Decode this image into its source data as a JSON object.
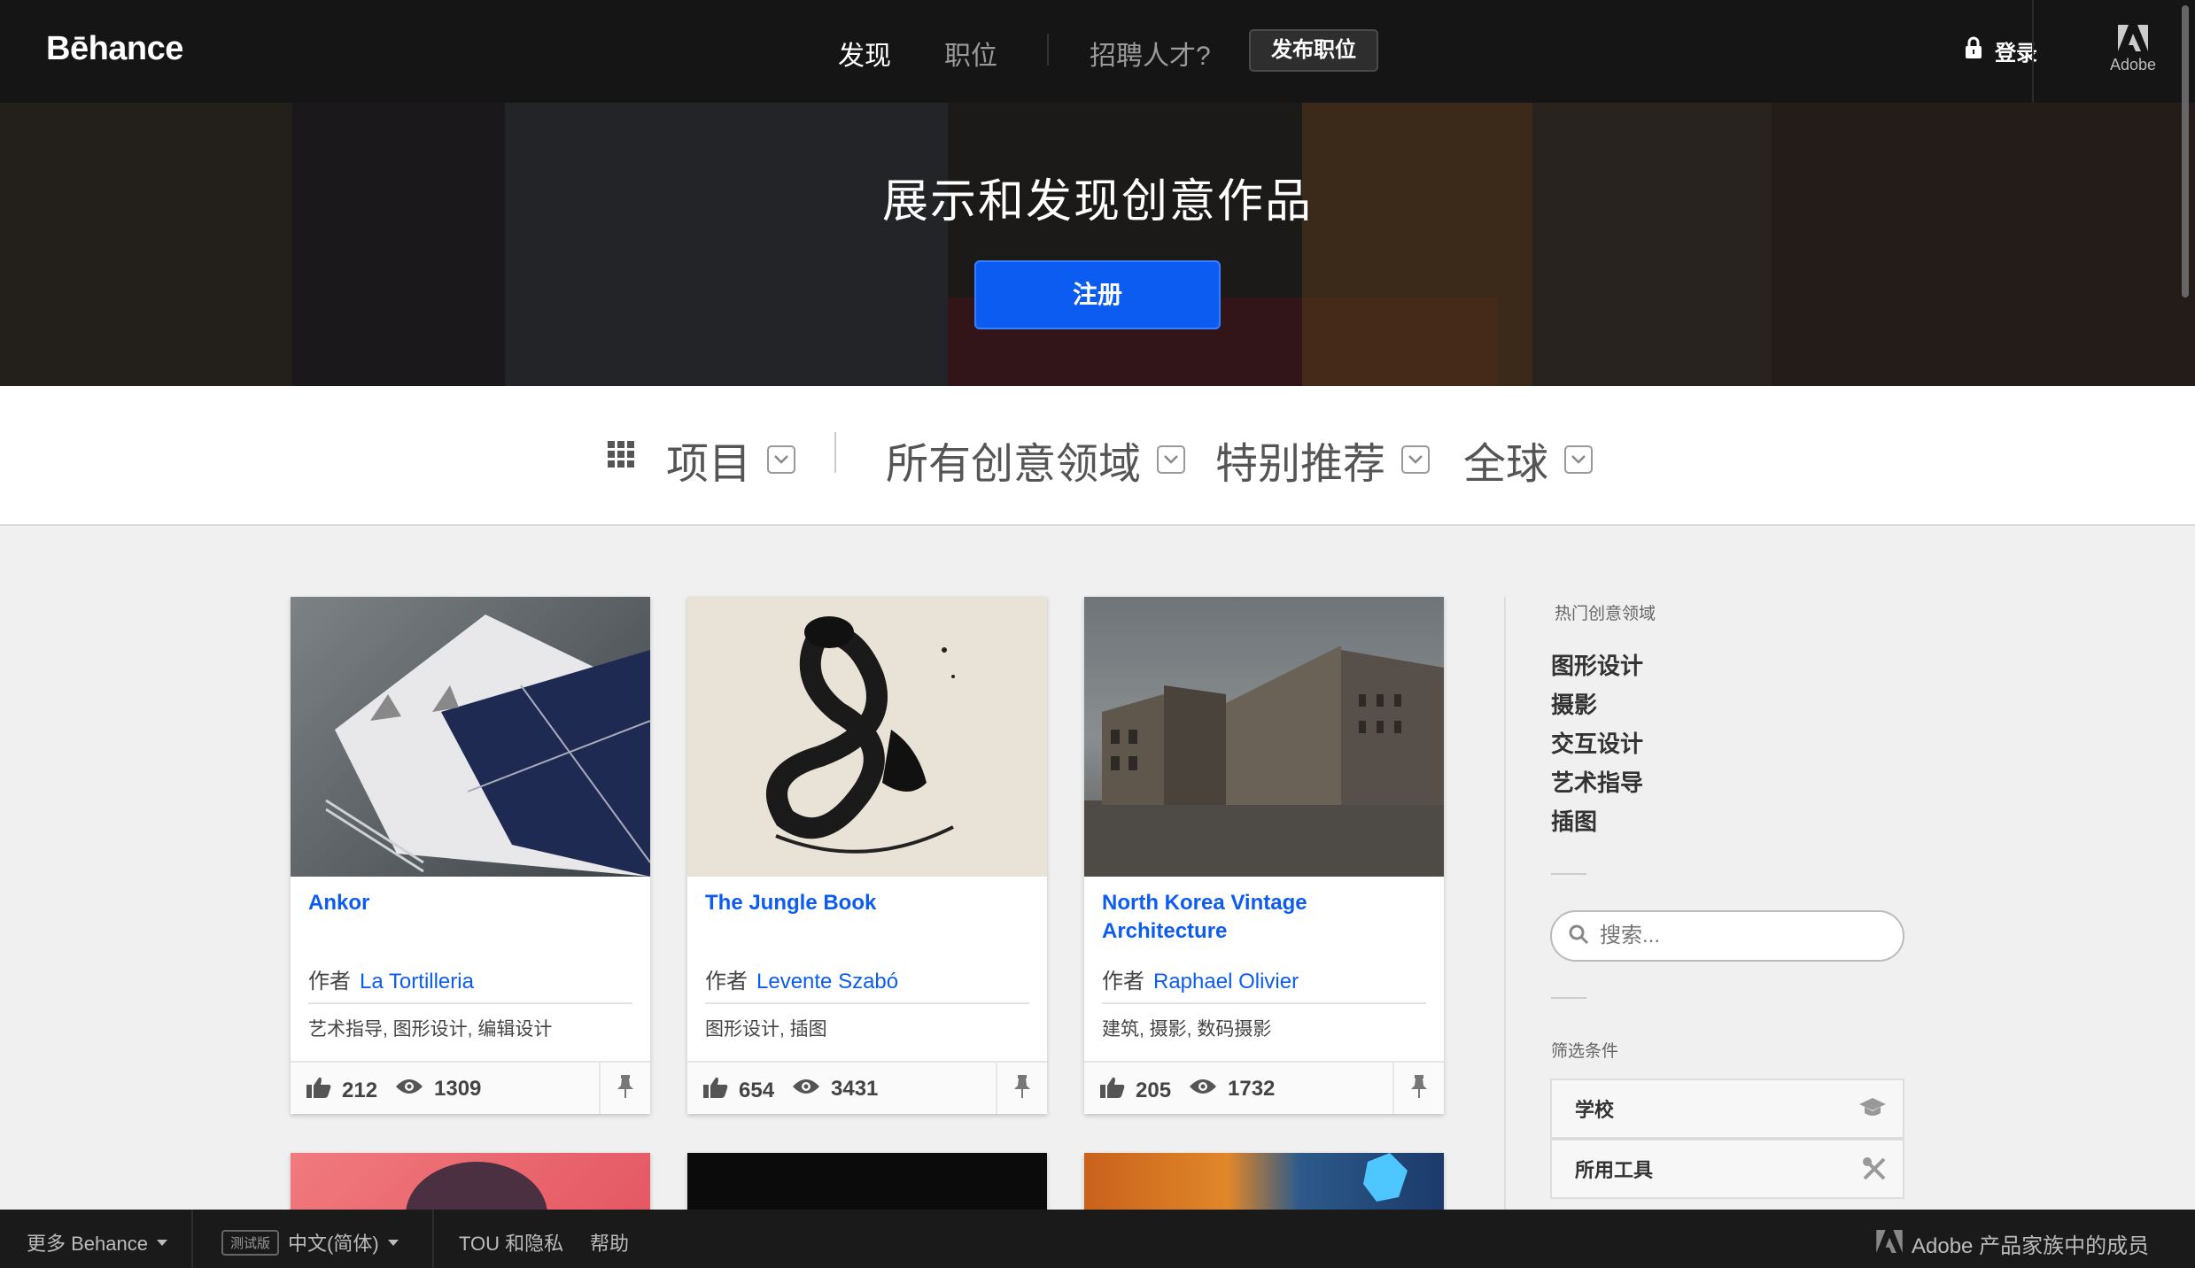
{
  "nav": {
    "logo": "Bēhance",
    "discover": "发现",
    "jobs": "职位",
    "hire": "招聘人才?",
    "post_job": "发布职位",
    "login": "登录",
    "adobe": "Adobe"
  },
  "hero": {
    "title": "展示和发现创意作品",
    "signup": "注册"
  },
  "filters": {
    "projects": "项目",
    "fields": "所有创意领域",
    "featured": "特别推荐",
    "location": "全球"
  },
  "cards": [
    {
      "title": "Ankor",
      "author_prefix": "作者",
      "author": "La Tortilleria",
      "fields": "艺术指导, 图形设计, 编辑设计",
      "likes": "212",
      "views": "1309"
    },
    {
      "title": "The Jungle Book",
      "author_prefix": "作者",
      "author": "Levente Szabó",
      "fields": "图形设计, 插图",
      "likes": "654",
      "views": "3431"
    },
    {
      "title": "North Korea Vintage Architecture",
      "author_prefix": "作者",
      "author": "Raphael Olivier",
      "fields": "建筑, 摄影, 数码摄影",
      "likes": "205",
      "views": "1732"
    }
  ],
  "sidebar": {
    "popular_heading": "热门创意领域",
    "popular": [
      "图形设计",
      "摄影",
      "交互设计",
      "艺术指导",
      "插图"
    ],
    "search_placeholder": "搜索...",
    "filter_heading": "筛选条件",
    "filters": [
      "学校",
      "所用工具"
    ]
  },
  "footer": {
    "more": "更多 Behance",
    "beta": "测试版",
    "language": "中文(简体)",
    "tou": "TOU 和隐私",
    "help": "帮助",
    "adobe_family": "Adobe 产品家族中的成员"
  }
}
